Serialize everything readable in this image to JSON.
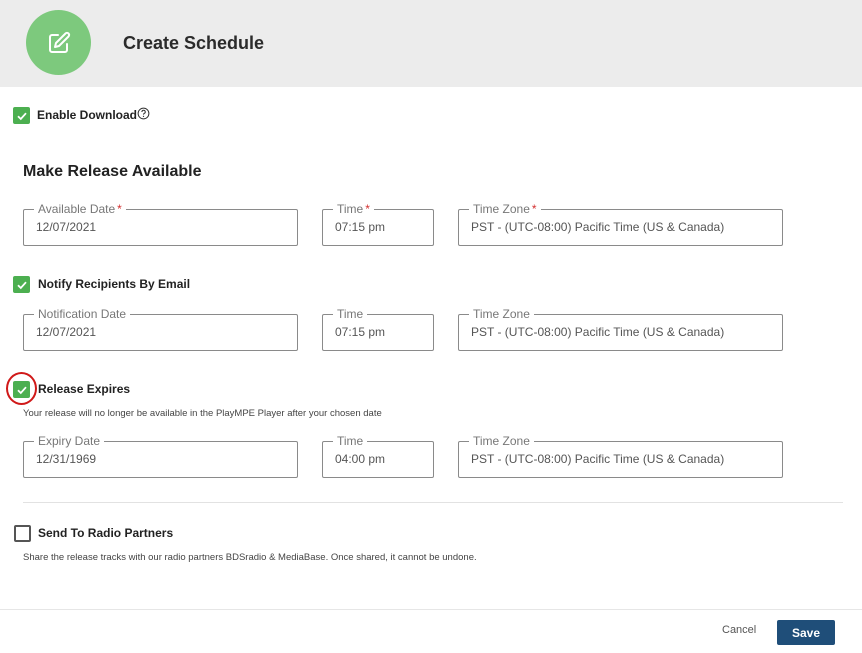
{
  "header": {
    "title": "Create Schedule",
    "icon": "edit-icon",
    "icon_bg": "#7dc97d"
  },
  "enable_download": {
    "label": "Enable Download",
    "checked": true,
    "help_icon": "help-circle-icon"
  },
  "release_available": {
    "section_title": "Make Release Available",
    "date": {
      "label": "Available Date",
      "required_mark": "*",
      "value": "12/07/2021"
    },
    "time": {
      "label": "Time",
      "required_mark": "*",
      "value": "07:15 pm"
    },
    "timezone": {
      "label": "Time Zone",
      "required_mark": "*",
      "value": "PST - (UTC-08:00) Pacific Time (US & Canada)"
    }
  },
  "notify": {
    "label": "Notify Recipients By Email",
    "checked": true,
    "date": {
      "label": "Notification Date",
      "value": "12/07/2021"
    },
    "time": {
      "label": "Time",
      "value": "07:15 pm"
    },
    "timezone": {
      "label": "Time Zone",
      "value": "PST - (UTC-08:00) Pacific Time (US & Canada)"
    }
  },
  "expires": {
    "label": "Release Expires",
    "checked": true,
    "hint": "Your release will no longer be available in the PlayMPE Player after your chosen date",
    "date": {
      "label": "Expiry Date",
      "value": "12/31/1969"
    },
    "time": {
      "label": "Time",
      "value": "04:00 pm"
    },
    "timezone": {
      "label": "Time Zone",
      "value": "PST - (UTC-08:00) Pacific Time (US & Canada)"
    }
  },
  "radio_partners": {
    "label": "Send To Radio Partners",
    "checked": false,
    "hint": "Share the release tracks with our radio partners BDSradio & MediaBase. Once shared, it cannot be undone."
  },
  "footer": {
    "cancel_label": "Cancel",
    "save_label": "Save"
  },
  "colors": {
    "checkbox_checked": "#4caf50",
    "save_button": "#1f4e79",
    "required": "#d32f2f",
    "annotation": "#d01919"
  }
}
